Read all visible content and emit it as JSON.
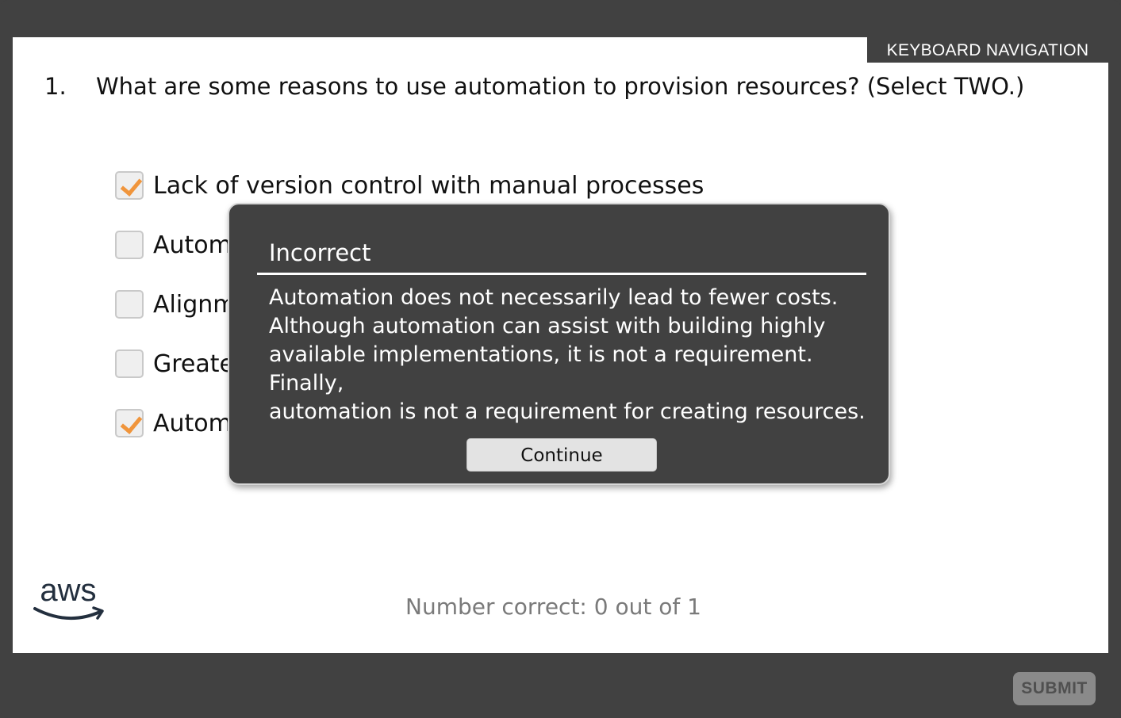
{
  "keyboard_nav_label": "KEYBOARD NAVIGATION",
  "question": {
    "number": "1.",
    "text": "What are some reasons to use automation to provision resources? (Select TWO.)"
  },
  "options": [
    {
      "label": "Lack of version control with manual processes",
      "checked": true
    },
    {
      "label": "Autom",
      "checked": false
    },
    {
      "label": "Alignm",
      "checked": false
    },
    {
      "label": "Greate",
      "checked": false
    },
    {
      "label": "Autom",
      "checked": true
    }
  ],
  "score_text": "Number correct: 0 out of 1",
  "submit_label": "SUBMIT",
  "feedback": {
    "title": "Incorrect",
    "lines": [
      "Automation does not necessarily lead to fewer costs.",
      "Although automation can assist with building highly",
      "available implementations, it is not a requirement. Finally,",
      "automation is not a requirement for creating resources."
    ],
    "continue_label": "Continue"
  },
  "logo": {
    "text": "aws",
    "name": "aws-logo"
  },
  "colors": {
    "frame": "#414141",
    "check_accent": "#f0953c",
    "modal_bg": "#414141",
    "submit_bg": "#8a8a8a"
  }
}
